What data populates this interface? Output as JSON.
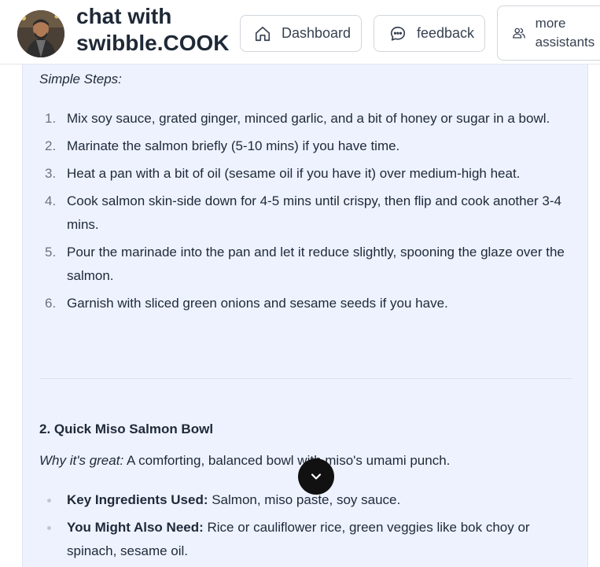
{
  "header": {
    "title": "chat with swibble.COOK",
    "nav": {
      "dashboard": "Dashboard",
      "feedback": "feedback",
      "more_assistants": "more assistants"
    }
  },
  "message": {
    "steps_heading": "Simple Steps:",
    "steps": [
      {
        "num": "1.",
        "text": "Mix soy sauce, grated ginger, minced garlic, and a bit of honey or sugar in a bowl."
      },
      {
        "num": "2.",
        "text": "Marinate the salmon briefly (5-10 mins) if you have time."
      },
      {
        "num": "3.",
        "text": "Heat a pan with a bit of oil (sesame oil if you have it) over medium-high heat."
      },
      {
        "num": "4.",
        "text": "Cook salmon skin-side down for 4-5 mins until crispy, then flip and cook another 3-4 mins."
      },
      {
        "num": "5.",
        "text": "Pour the marinade into the pan and let it reduce slightly, spooning the glaze over the salmon."
      },
      {
        "num": "6.",
        "text": "Garnish with sliced green onions and sesame seeds if you have."
      }
    ],
    "recipe2_title": "2. Quick Miso Salmon Bowl",
    "recipe2_why_label": "Why it's great:",
    "recipe2_why_text": " A comforting, balanced bowl with miso's umami punch.",
    "ingredients": [
      {
        "label": "Key Ingredients Used:",
        "text": " Salmon, miso paste, soy sauce."
      },
      {
        "label": "You Might Also Need:",
        "text": " Rice or cauliflower rice, green veggies like bok choy or spinach, sesame oil."
      }
    ]
  },
  "icons": {
    "dashboard": "home-icon",
    "feedback": "chat-bubble-icon",
    "more": "users-icon",
    "scroll": "chevron-down-icon"
  },
  "colors": {
    "panel_bg": "#eef2ff",
    "scroll_button": "#111111"
  }
}
